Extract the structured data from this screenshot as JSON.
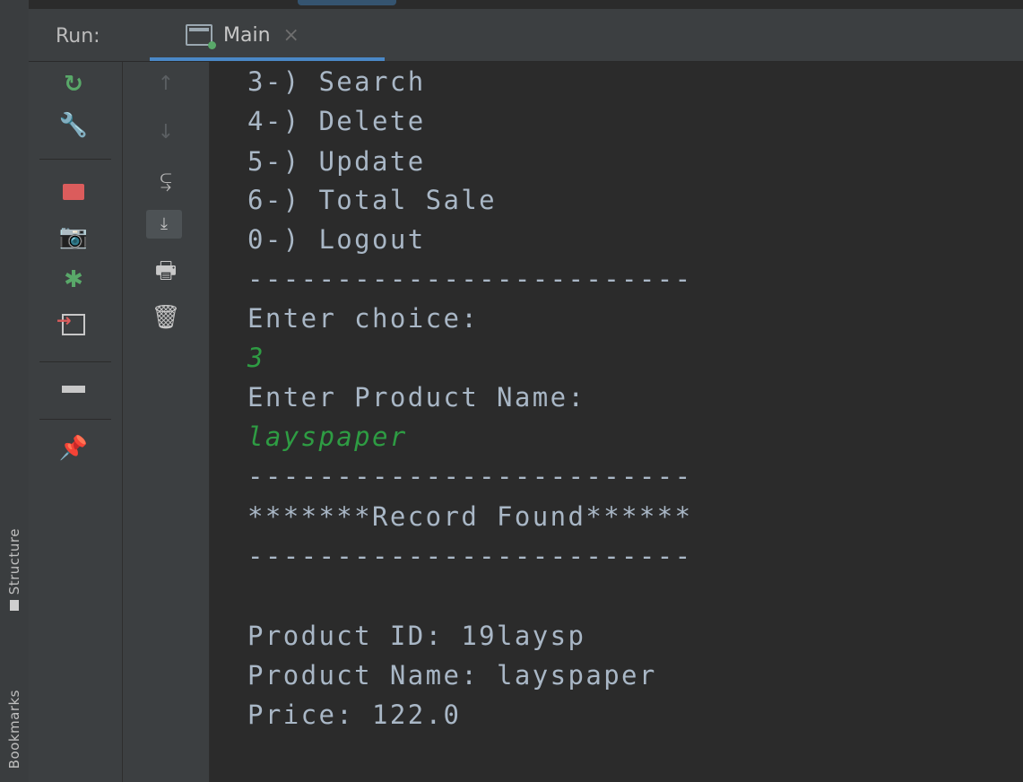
{
  "run_panel": {
    "label": "Run:",
    "tab": {
      "title": "Main",
      "close": "×"
    }
  },
  "side_tabs": {
    "structure": "Structure",
    "bookmarks": "Bookmarks"
  },
  "toolbar": {
    "left_icons": [
      "rerun-icon",
      "wrench-icon",
      "stop-icon",
      "camera-icon",
      "debug-icon",
      "login-icon",
      "layout-icon",
      "pin-icon"
    ],
    "right_icons": [
      "up-arrow-icon",
      "down-arrow-icon",
      "soft-wrap-icon",
      "scroll-to-end-icon",
      "print-icon",
      "trash-icon"
    ],
    "colors": {
      "rerun": "#59a869",
      "stop": "#db5c5c",
      "active_tab": "#4a88c7"
    }
  },
  "console": {
    "lines": [
      {
        "text": "3-) Search",
        "type": "output"
      },
      {
        "text": "4-) Delete",
        "type": "output"
      },
      {
        "text": "5-) Update",
        "type": "output"
      },
      {
        "text": "6-) Total Sale",
        "type": "output"
      },
      {
        "text": "0-) Logout",
        "type": "output"
      },
      {
        "text": "-------------------------",
        "type": "output"
      },
      {
        "text": "Enter choice:",
        "type": "output"
      },
      {
        "text": "3",
        "type": "input"
      },
      {
        "text": "Enter Product Name:",
        "type": "output"
      },
      {
        "text": "layspaper",
        "type": "input"
      },
      {
        "text": "-------------------------",
        "type": "output"
      },
      {
        "text": "*******Record Found******",
        "type": "output"
      },
      {
        "text": "-------------------------",
        "type": "output"
      },
      {
        "text": "Product ID: 19laysp",
        "type": "output"
      },
      {
        "text": "Product Name: layspaper",
        "type": "output"
      },
      {
        "text": "Price: 122.0",
        "type": "output"
      }
    ],
    "colors": {
      "output": "#a9b7c6",
      "input": "#2e9c43"
    }
  }
}
